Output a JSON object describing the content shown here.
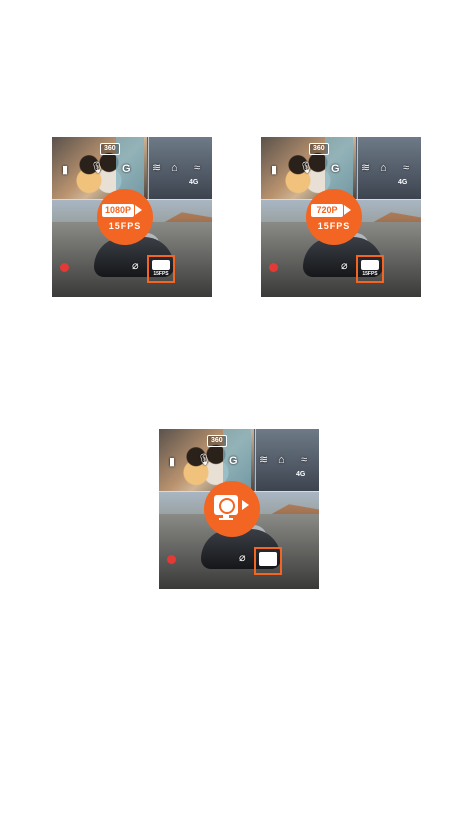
{
  "screens": [
    {
      "badge": "360",
      "network": "4G",
      "mode_label": "1080P",
      "fps_label": "15FPS",
      "selected_icon": "1080P",
      "selected_sub": "15FPS"
    },
    {
      "badge": "360",
      "network": "4G",
      "mode_label": "720P",
      "fps_label": "15FPS",
      "selected_icon": "720P",
      "selected_sub": "15FPS"
    },
    {
      "badge": "360",
      "network": "4G",
      "mode_icon": "timelapse-camera-icon",
      "selected_icon": "timelapse-camera-icon"
    }
  ],
  "colors": {
    "accent": "#f26522",
    "record": "#e53935",
    "highlight": "#7fb3c4"
  }
}
